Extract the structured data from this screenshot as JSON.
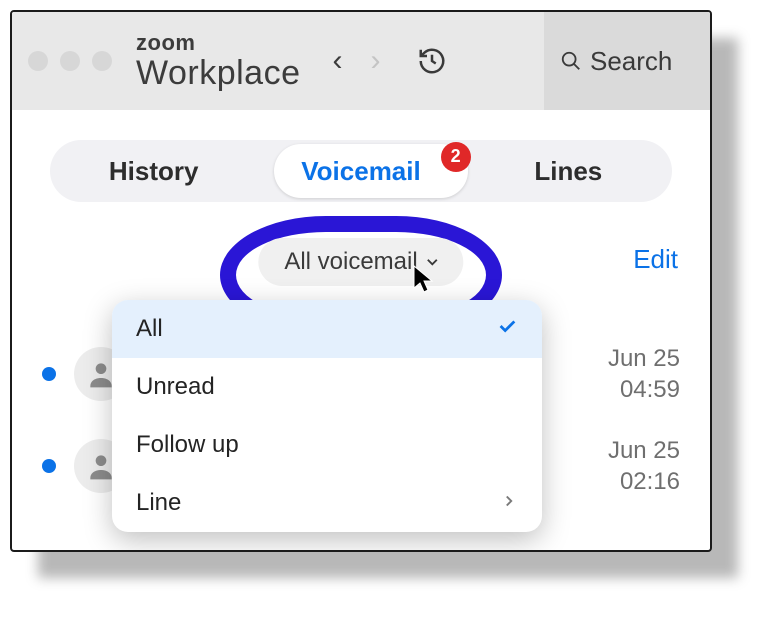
{
  "brand": {
    "line1": "zoom",
    "line2": "Workplace"
  },
  "search": {
    "placeholder": "Search"
  },
  "tabs": {
    "history": "History",
    "voicemail": "Voicemail",
    "lines": "Lines",
    "badge": "2"
  },
  "filter": {
    "label": "All voicemail",
    "edit": "Edit"
  },
  "dropdown": {
    "all": "All",
    "unread": "Unread",
    "follow_up": "Follow up",
    "line": "Line"
  },
  "rows": [
    {
      "date": "Jun 25",
      "time": "04:59"
    },
    {
      "date": "Jun 25",
      "time": "02:16"
    }
  ]
}
